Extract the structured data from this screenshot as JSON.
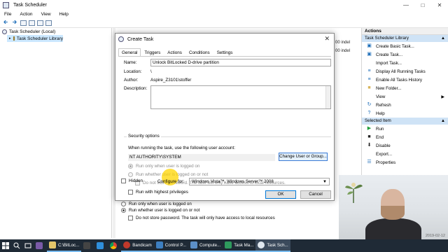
{
  "window": {
    "title": "Task Scheduler"
  },
  "menu": [
    "File",
    "Action",
    "View",
    "Help"
  ],
  "tree": {
    "root": "Task Scheduler (Local)",
    "library": "Task Scheduler Library"
  },
  "background": {
    "frag1": "00 indel",
    "frag2": "00 indel",
    "opt_logged_on": "Run only when user is logged on",
    "opt_logged_or_not": "Run whether user is logged on or not",
    "opt_no_store": "Do not store password.  The task will only have access to local resources"
  },
  "actions_panel": {
    "header": "Actions",
    "library_section": "Task Scheduler Library",
    "library_items": [
      {
        "label": "Create Basic Task...",
        "icon": "task-icon"
      },
      {
        "label": "Create Task...",
        "icon": "task-icon"
      },
      {
        "label": "Import Task...",
        "icon": "blank"
      },
      {
        "label": "Display All Running Tasks",
        "icon": "list-icon"
      },
      {
        "label": "Enable All Tasks History",
        "icon": "list-icon"
      },
      {
        "label": "New Folder...",
        "icon": "folder-icon"
      },
      {
        "label": "View",
        "icon": "blank",
        "submenu": true
      },
      {
        "label": "Refresh",
        "icon": "refresh-icon"
      },
      {
        "label": "Help",
        "icon": "help-icon"
      }
    ],
    "selected_section": "Selected Item",
    "selected_items": [
      {
        "label": "Run",
        "icon": "run-icon"
      },
      {
        "label": "End",
        "icon": "end-icon"
      },
      {
        "label": "Disable",
        "icon": "disable-icon"
      },
      {
        "label": "Export...",
        "icon": "blank"
      },
      {
        "label": "Properties",
        "icon": "properties-icon"
      }
    ]
  },
  "dialog": {
    "title": "Create Task",
    "tabs": [
      "General",
      "Triggers",
      "Actions",
      "Conditions",
      "Settings"
    ],
    "name_label": "Name:",
    "name_value": "Unlock BitLocked D-drive partition",
    "location_label": "Location:",
    "location_value": "\\",
    "author_label": "Author:",
    "author_value": "Aspire_Z3101\\stoffer",
    "description_label": "Description:",
    "security_title": "Security options",
    "account_prompt": "When running the task, use the following user account:",
    "account_value": "NT AUTHORITY\\SYSTEM",
    "change_button": "Change User or Group...",
    "opt_logged_on": "Run only when user is logged on",
    "opt_logged_or_not": "Run whether user is logged on or not",
    "opt_no_store": "Do not store password.  The task will only have access to local resources.",
    "opt_highest": "Run with highest privileges",
    "hidden_label": "Hidden",
    "configure_label": "Configure for:",
    "configure_value": "Windows Vista™, Windows Server™ 2008",
    "ok": "OK",
    "cancel": "Cancel"
  },
  "taskbar": {
    "items": [
      "C:\\BitLoc...",
      "Bandicam",
      "Control P...",
      "Compute...",
      "Task Ma...",
      "Task Sch..."
    ],
    "date": "2019-02-12"
  }
}
